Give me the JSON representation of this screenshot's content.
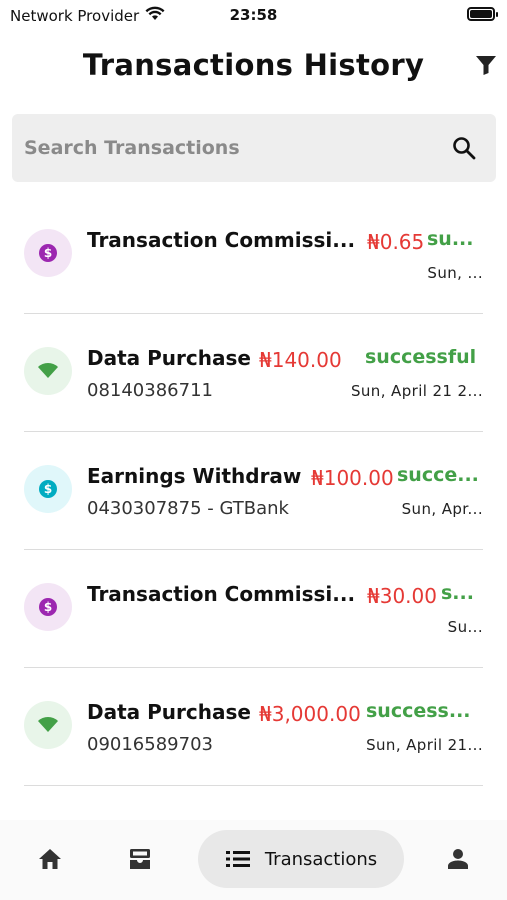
{
  "status_bar": {
    "carrier": "Network Provider",
    "time": "23:58"
  },
  "header": {
    "title": "Transactions History"
  },
  "search": {
    "placeholder": "Search Transactions"
  },
  "transactions": [
    {
      "title": "Transaction Commissi...",
      "subtitle": "",
      "amount": "₦0.65",
      "status": "su...",
      "date": "Sun, ...",
      "icon": "dollar-coin-icon",
      "icon_color": "#9c27b0",
      "icon_bg": "#f3e5f5"
    },
    {
      "title": "Data Purchase",
      "subtitle": "08140386711",
      "amount": "₦140.00",
      "status": "successful",
      "date": "Sun, April 21 2...",
      "icon": "wifi-icon",
      "icon_color": "#43a047",
      "icon_bg": "#e8f5e9"
    },
    {
      "title": "Earnings Withdraw",
      "subtitle": "0430307875 - GTBank",
      "amount": "₦100.00",
      "status": "succe...",
      "date": "Sun, Apr...",
      "icon": "dollar-coin-icon",
      "icon_color": "#00acc1",
      "icon_bg": "#e0f7fa"
    },
    {
      "title": "Transaction Commissi...",
      "subtitle": "",
      "amount": "₦30.00",
      "status": "s...",
      "date": "Su...",
      "icon": "dollar-coin-icon",
      "icon_color": "#9c27b0",
      "icon_bg": "#f3e5f5"
    },
    {
      "title": "Data Purchase",
      "subtitle": "09016589703",
      "amount": "₦3,000.00",
      "status": "success...",
      "date": "Sun, April 21...",
      "icon": "wifi-icon",
      "icon_color": "#43a047",
      "icon_bg": "#e8f5e9"
    }
  ],
  "bottom_nav": {
    "items": [
      {
        "icon": "home-icon"
      },
      {
        "icon": "inbox-icon"
      },
      {
        "icon": "list-icon",
        "label": "Transactions",
        "active": true
      },
      {
        "icon": "person-icon"
      }
    ]
  },
  "colors": {
    "amount": "#e53935",
    "status_success": "#43a047",
    "active_nav_bg": "#e8e8e8",
    "search_bg": "#eeeeee"
  }
}
